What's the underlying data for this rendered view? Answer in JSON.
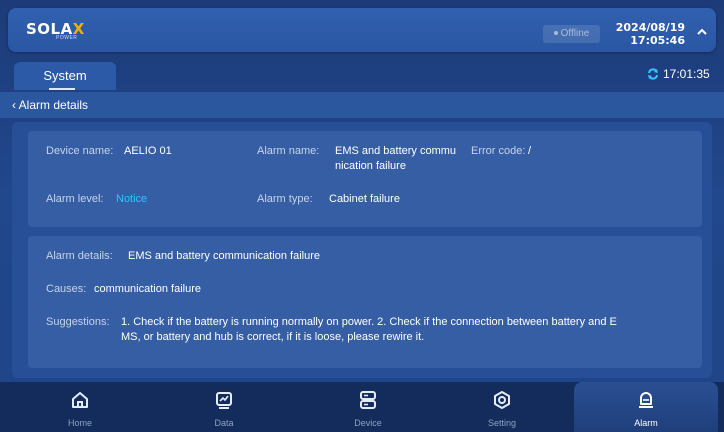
{
  "header": {
    "logo_text": "SOLAX",
    "logo_sub": "POWER",
    "status": "Offline",
    "date": "2024/08/19",
    "time": "17:05:46"
  },
  "tabs": {
    "active": "System",
    "sync_time": "17:01:35"
  },
  "breadcrumb": {
    "back_label": "Alarm details"
  },
  "alarm": {
    "device_name_label": "Device name:",
    "device_name": "AELIO 01",
    "alarm_name_label": "Alarm name:",
    "alarm_name_line1": "EMS and battery commu",
    "alarm_name_line2": "nication failure",
    "error_code_label": "Error code:",
    "error_code": "/",
    "alarm_level_label": "Alarm level:",
    "alarm_level": "Notice",
    "alarm_type_label": "Alarm type:",
    "alarm_type": "Cabinet failure",
    "details_label": "Alarm details:",
    "details": "EMS and battery communication failure",
    "causes_label": "Causes:",
    "causes": "communication failure",
    "suggestions_label": "Suggestions:",
    "suggestions_line1": "1. Check if the battery is running normally on power. 2. Check if the connection between battery and E",
    "suggestions_line2": "MS, or battery and hub is correct, if it is loose, please rewire it."
  },
  "nav": {
    "items": [
      {
        "label": "Home",
        "icon": "home-icon"
      },
      {
        "label": "Data",
        "icon": "chart-icon"
      },
      {
        "label": "Device",
        "icon": "server-icon"
      },
      {
        "label": "Setting",
        "icon": "gear-icon"
      },
      {
        "label": "Alarm",
        "icon": "alarm-icon"
      }
    ],
    "active": "Alarm"
  },
  "colors": {
    "accent": "#2ec4ff",
    "brand_x": "#f0b000"
  }
}
